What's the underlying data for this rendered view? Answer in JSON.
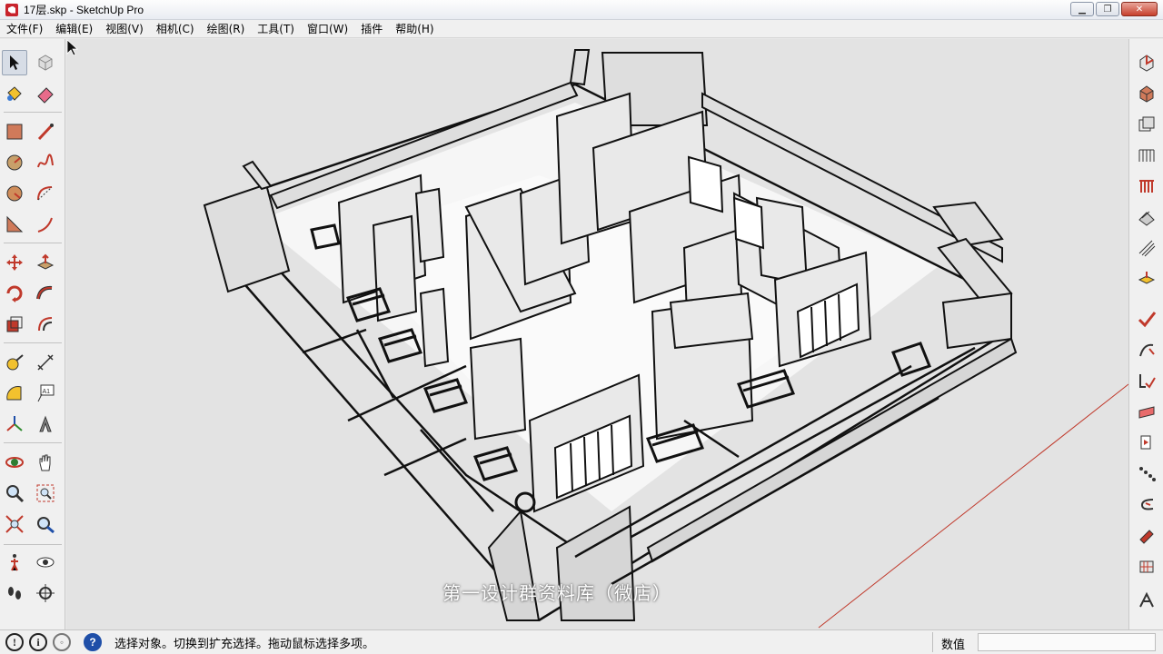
{
  "window": {
    "title": "17层.skp - SketchUp Pro",
    "buttons": {
      "minimize": "▁",
      "maximize": "❐",
      "close": "✕"
    }
  },
  "menu": {
    "items": [
      "文件(F)",
      "编辑(E)",
      "视图(V)",
      "相机(C)",
      "绘图(R)",
      "工具(T)",
      "窗口(W)",
      "插件",
      "帮助(H)"
    ]
  },
  "left_toolbar": {
    "tools": [
      "select-icon",
      "component-icon",
      "paint-bucket-icon",
      "eraser-icon",
      "rectangle-icon",
      "line-icon",
      "circle-icon",
      "freehand-icon",
      "polygon-icon",
      "arc-icon",
      "pie-icon",
      "two-point-arc-icon",
      "move-icon",
      "push-pull-icon",
      "rotate-icon",
      "follow-me-icon",
      "scale-icon",
      "offset-icon",
      "tape-measure-icon",
      "dimension-icon",
      "protractor-icon",
      "text-icon",
      "axes-icon",
      "3d-text-icon",
      "orbit-icon",
      "pan-icon",
      "zoom-icon",
      "zoom-window-icon",
      "zoom-extents-icon",
      "previous-view-icon",
      "walk-icon",
      "look-around-icon",
      "footprints-icon",
      "position-camera-icon"
    ],
    "text_tool_label": "A1"
  },
  "right_toolbar": {
    "tools": [
      "solid-tools-icon",
      "outer-shell-icon",
      "intersect-icon",
      "union-icon",
      "subtract-icon",
      "trim-icon",
      "split-icon",
      "section-plane-icon",
      "check-icon",
      "sandbox-icon",
      "drape-icon",
      "stamp-icon",
      "flip-edge-icon",
      "smoove-icon",
      "from-contours-icon",
      "add-detail-icon",
      "grid-icon",
      "warehouse-icon"
    ]
  },
  "viewport": {
    "subtitle": "第一设计群资料库（微店）",
    "background": "#e3e3e3"
  },
  "status": {
    "message": "选择对象。切换到扩充选择。拖动鼠标选择多项。",
    "measurements_label": "数值",
    "measurements_value": ""
  },
  "colors": {
    "accent_red": "#c8232c",
    "help_blue": "#1f4fa8",
    "axis_red": "#c0392b"
  }
}
